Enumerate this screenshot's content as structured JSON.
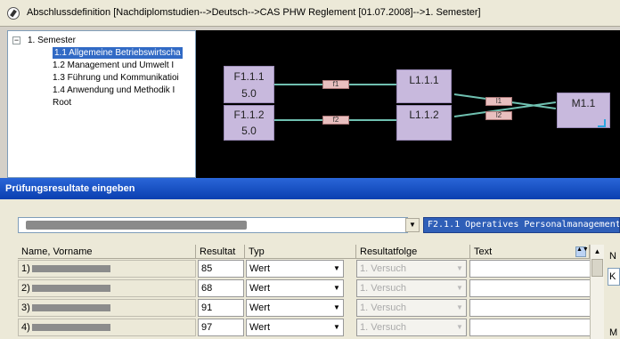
{
  "window": {
    "title": "Abschlussdefinition [Nachdiplomstudien-->Deutsch-->CAS PHW Reglement [01.07.2008]-->1. Semester]",
    "icon": "no-entry-icon"
  },
  "tree": {
    "root": "1. Semester",
    "items": [
      "1.1 Allgemeine Betriebswirtscha",
      "1.2 Management und Umwelt I",
      "1.3 Führung und Kommunikatioi",
      "1.4 Anwendung und Methodik I",
      "Root"
    ],
    "selected_index": 0
  },
  "graph": {
    "nodes": [
      {
        "id": "F1.1.1",
        "value": "5.0"
      },
      {
        "id": "F1.1.2",
        "value": "5.0"
      },
      {
        "id": "L1.1.1",
        "value": ""
      },
      {
        "id": "L1.1.2",
        "value": ""
      },
      {
        "id": "M1.1",
        "value": ""
      }
    ],
    "tags": [
      "f1",
      "f2",
      "l1",
      "l2"
    ],
    "node_color": "#c8b9dd",
    "connector_color": "#6fc0b0",
    "tag_color": "#e9bfbf"
  },
  "dialog": {
    "title": "Prüfungsresultate eingeben",
    "reglement_select": "",
    "module_select": "F2.1.1 Operatives Personalmanagement I",
    "columns": [
      "Name, Vorname",
      "Resultat",
      "Typ",
      "Resultatfolge",
      "Text"
    ],
    "rows": [
      {
        "index": "1)",
        "resultat": "85",
        "typ": "Wert",
        "folge": "1. Versuch",
        "text": ""
      },
      {
        "index": "2)",
        "resultat": "68",
        "typ": "Wert",
        "folge": "1. Versuch",
        "text": ""
      },
      {
        "index": "3)",
        "resultat": "91",
        "typ": "Wert",
        "folge": "1. Versuch",
        "text": ""
      },
      {
        "index": "4)",
        "resultat": "97",
        "typ": "Wert",
        "folge": "1. Versuch",
        "text": ""
      }
    ],
    "side_label_top": "N",
    "side_field_value": "K",
    "side_label_bottom": "M"
  }
}
